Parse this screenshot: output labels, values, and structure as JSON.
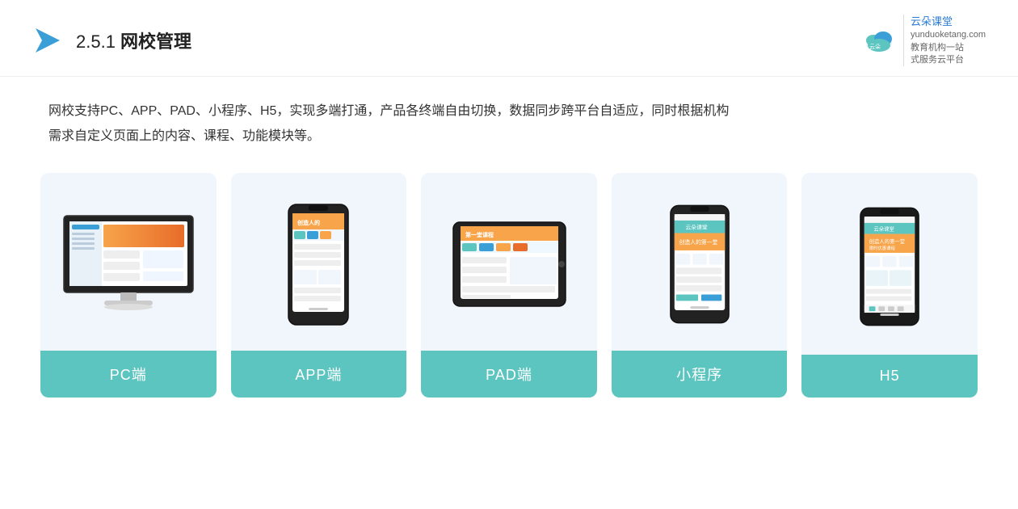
{
  "header": {
    "title_prefix": "2.5.1 ",
    "title_main": "网校管理",
    "brand_name": "云朵课堂",
    "brand_domain": "yunduoketang.com",
    "brand_tagline_1": "教育机构一站",
    "brand_tagline_2": "式服务云平台"
  },
  "description": {
    "text_line1": "网校支持PC、APP、PAD、小程序、H5，实现多端打通，产品各终端自由切换，数据同步跨平台自适应，同时根据机构",
    "text_line2": "需求自定义页面上的内容、课程、功能模块等。"
  },
  "cards": [
    {
      "id": "pc",
      "label": "PC端"
    },
    {
      "id": "app",
      "label": "APP端"
    },
    {
      "id": "pad",
      "label": "PAD端"
    },
    {
      "id": "miniprogram",
      "label": "小程序"
    },
    {
      "id": "h5",
      "label": "H5"
    }
  ],
  "colors": {
    "card_bg": "#f0f6fb",
    "card_label_bg": "#5dc5c0",
    "accent_blue": "#2d7dd2",
    "title_color": "#222",
    "text_color": "#333"
  }
}
